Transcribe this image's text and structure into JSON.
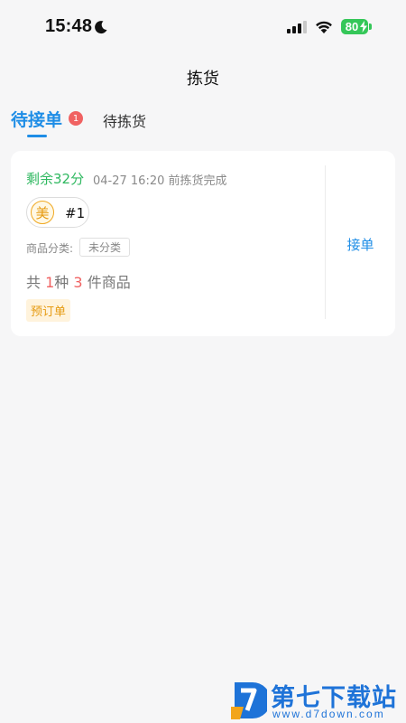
{
  "status_bar": {
    "time": "15:48",
    "battery": "80",
    "battery_color": "#35c759"
  },
  "header": {
    "title": "拣货"
  },
  "tabs": [
    {
      "label": "待接单",
      "badge": "1",
      "active": true
    },
    {
      "label": "待拣货",
      "active": false
    }
  ],
  "order": {
    "time_remaining": "剩余32分",
    "deadline": "04-27 16:20 前拣货完成",
    "platform_icon": "美",
    "order_number": "#1",
    "category_label": "商品分类:",
    "category_value": "未分类",
    "summary": {
      "prefix": "共",
      "kinds": "1",
      "kinds_unit": "种",
      "count": "3",
      "count_unit": "件商品"
    },
    "tag": "预订单",
    "accept_label": "接单"
  },
  "watermark": {
    "name": "第七下载站",
    "url": "www.d7down.com"
  },
  "colors": {
    "accent": "#1e8de6",
    "timer": "#2fb860",
    "badge": "#f06262",
    "tag_bg": "#fff3dc",
    "tag_text": "#e69a10"
  },
  "icons": [
    "moon-icon",
    "cellular-signal-icon",
    "wifi-icon",
    "battery-icon",
    "charging-bolt-icon",
    "meituan-icon",
    "d7-logo-icon"
  ]
}
